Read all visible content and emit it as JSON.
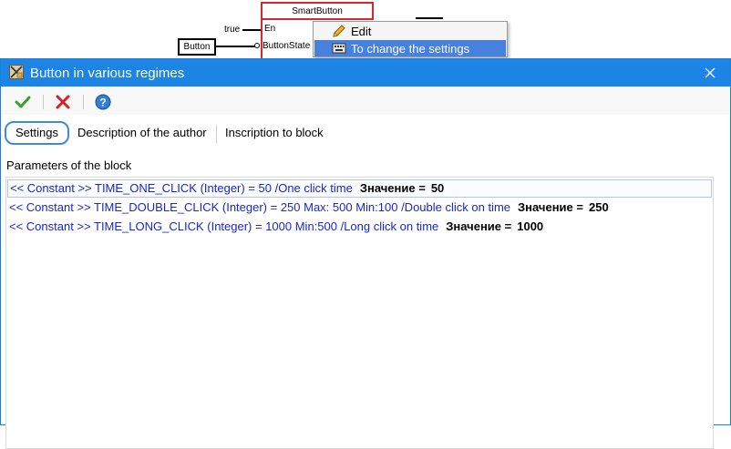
{
  "diagram": {
    "block_title": "SmartButton",
    "port_en": "En",
    "port_button_state": "ButtonState",
    "input_true": "true",
    "input_button": "Button",
    "red": "#d8262d"
  },
  "context_menu": {
    "items": [
      {
        "label": "Edit",
        "icon": "pencil-icon",
        "selected": false
      },
      {
        "label": "To change the settings",
        "icon": "keyboard-icon",
        "selected": true
      }
    ],
    "selected_color": "#4681de"
  },
  "dialog": {
    "title": "Button in various regimes",
    "title_icon": "block-icon",
    "close_icon": "close-icon",
    "accent": "#1c84e4",
    "toolbar": {
      "ok_icon": "checkmark-icon",
      "cancel_icon": "x-icon",
      "help_icon": "help-icon"
    },
    "tabs": [
      {
        "label": "Settings",
        "active": true
      },
      {
        "label": "Description of the author",
        "active": false
      },
      {
        "label": "Inscription to block",
        "active": false
      }
    ],
    "section_label": "Parameters of the block",
    "parameters": [
      {
        "text": "<< Constant >>  TIME_ONE_CLICK (Integer) = 50 /One click time",
        "value_label": "Значение =",
        "value": "50"
      },
      {
        "text": "<< Constant >>  TIME_DOUBLE_CLICK (Integer) = 250 Max: 500 Min:100 /Double click on time",
        "value_label": "Значение =",
        "value": "250"
      },
      {
        "text": "<< Constant >>  TIME_LONG_CLICK (Integer) = 1000 Min:500 /Long click on time",
        "value_label": "Значение =",
        "value": "1000"
      }
    ]
  }
}
